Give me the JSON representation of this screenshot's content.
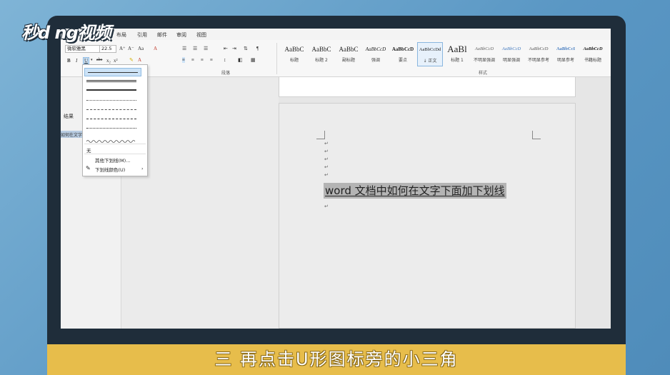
{
  "logo": "秒d    ng视频",
  "menu": {
    "tabs": [
      "布局",
      "引用",
      "邮件",
      "审阅",
      "视图"
    ]
  },
  "ribbon": {
    "font_name": "微软雅黑",
    "font_size": "22.5",
    "grow_font": "A⁺",
    "shrink_font": "A⁻",
    "case": "Aa",
    "clear_format": "A",
    "bold": "B",
    "italic": "I",
    "underline": "U",
    "strikethrough": "abc",
    "subscript": "x₂",
    "superscript": "x²",
    "paragraph_label": "段落",
    "styles_label": "样式"
  },
  "styles": [
    {
      "sample": "AaBbC",
      "name": "标题"
    },
    {
      "sample": "AaBbC",
      "name": "标题 2"
    },
    {
      "sample": "AaBbC",
      "name": "副标题"
    },
    {
      "sample": "AaBbCcD",
      "name": "强调"
    },
    {
      "sample": "AaBbCcD",
      "name": "要点"
    },
    {
      "sample": "AaBbCcDd",
      "name": "↓ 正文"
    },
    {
      "sample": "AaBl",
      "name": "标题 1"
    },
    {
      "sample": "AaBbCcD",
      "name": "不明显强调"
    },
    {
      "sample": "AaBbCcD",
      "name": "明显强调"
    },
    {
      "sample": "AaBbCcD",
      "name": "不明显参考"
    },
    {
      "sample": "AaBbCcI",
      "name": "明显参考"
    },
    {
      "sample": "AaBbCcD",
      "name": "书籍标题"
    }
  ],
  "left_panel": {
    "results_label": "结果",
    "snippet": "如何在文字"
  },
  "underline_menu": {
    "none": "无",
    "more": "其他下划线(M)...",
    "color": "下划线颜色(U)",
    "arrow": "›"
  },
  "document": {
    "text": "word 文档中如何在文字下面加下划线",
    "para_mark": "↵"
  },
  "caption": "三 再点击U形图标旁的小三角",
  "colors": {
    "caption_bg": "#e7bd4b",
    "monitor": "#1f2d3a",
    "highlight": "#cde3f7"
  }
}
